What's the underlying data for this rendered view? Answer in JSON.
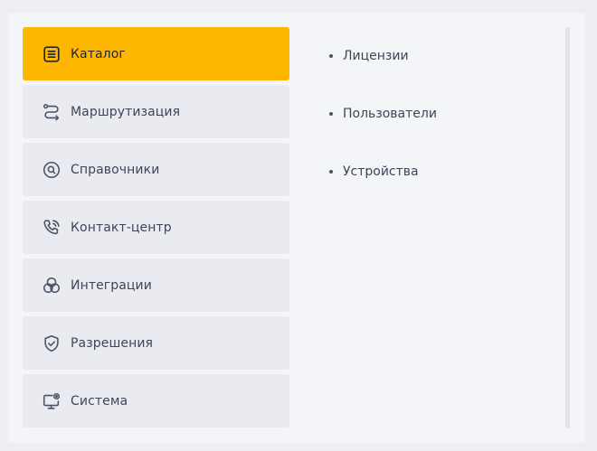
{
  "menu": {
    "items": [
      {
        "label": "Каталог",
        "icon": "catalog-icon",
        "active": true
      },
      {
        "label": "Маршрутизация",
        "icon": "routing-icon"
      },
      {
        "label": "Справочники",
        "icon": "search-circle-icon"
      },
      {
        "label": "Контакт-центр",
        "icon": "phone-icon"
      },
      {
        "label": "Интеграции",
        "icon": "circles-icon"
      },
      {
        "label": "Разрешения",
        "icon": "shield-check-icon"
      },
      {
        "label": "Система",
        "icon": "monitor-gear-icon"
      }
    ]
  },
  "submenu": {
    "items": [
      {
        "label": "Лицензии"
      },
      {
        "label": "Пользователи"
      },
      {
        "label": "Устройства"
      }
    ]
  },
  "colors": {
    "accent": "#fdb700",
    "background": "#eceef2",
    "panel": "#f4f5f8",
    "item": "#e9ebf0",
    "text": "#3d4558"
  }
}
